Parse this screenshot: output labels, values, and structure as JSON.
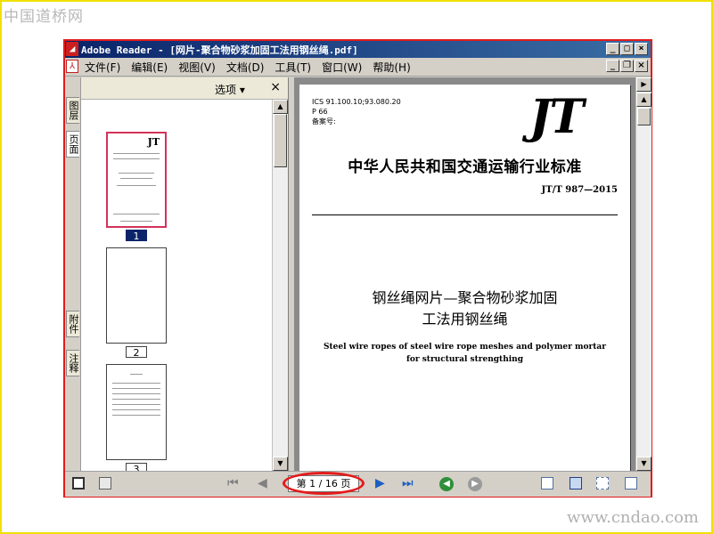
{
  "site": {
    "logo": "中国道桥网",
    "url": "www.cndao.com"
  },
  "window": {
    "title": "Adobe Reader - [网片-聚合物砂浆加固工法用钢丝绳.pdf]"
  },
  "menu": {
    "items": [
      "文件(F)",
      "编辑(E)",
      "视图(V)",
      "文档(D)",
      "工具(T)",
      "窗口(W)",
      "帮助(H)"
    ]
  },
  "sidetabs": {
    "layers": "图层",
    "pages": "页面",
    "attachments": "附件",
    "comments": "注释"
  },
  "panel": {
    "options_label": "选项 ▾",
    "close_label": "×"
  },
  "thumbnails": [
    {
      "page": "1",
      "selected": true
    },
    {
      "page": "2",
      "selected": false
    },
    {
      "page": "3",
      "selected": false
    }
  ],
  "document": {
    "ics": "ICS 91.100.10;93.080.20",
    "p": "P 66",
    "record": "备案号:",
    "logo": "JT",
    "standard_title": "中华人民共和国交通运输行业标准",
    "standard_code": "JT/T 987—2015",
    "cn_title_line1": "钢丝绳网片—聚合物砂浆加固",
    "cn_title_line2": "工法用钢丝绳",
    "en_title_line1": "Steel wire ropes of steel wire rope meshes and polymer mortar",
    "en_title_line2": "for structural strengthing"
  },
  "status": {
    "page_indicator": "第 1 / 16 页"
  },
  "colors": {
    "highlight": "#e31b1b",
    "titlebar": "#0a246a",
    "border": "#f0e000"
  }
}
